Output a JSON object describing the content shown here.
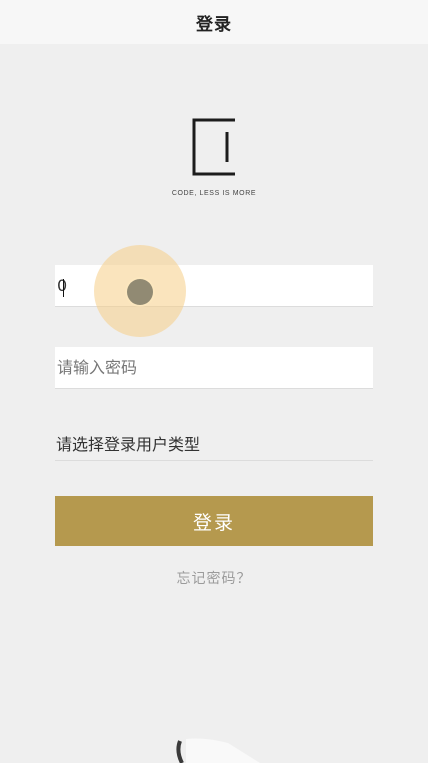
{
  "header": {
    "title": "登录"
  },
  "brand": {
    "tagline": "CODE, LESS IS MORE"
  },
  "form": {
    "username": {
      "value": "0",
      "placeholder": ""
    },
    "password": {
      "value": "",
      "placeholder": "请输入密码"
    },
    "user_type": {
      "label": "请选择登录用户类型"
    },
    "submit_label": "登录",
    "forgot_label": "忘记密码？"
  },
  "colors": {
    "primary_button": "#b5994e",
    "background": "#efefef",
    "header_background": "#f7f7f7",
    "touch_indicator": "#f5cd87"
  },
  "icons": {
    "logo": "code-less-logo-icon",
    "touch": "touch-indicator"
  }
}
